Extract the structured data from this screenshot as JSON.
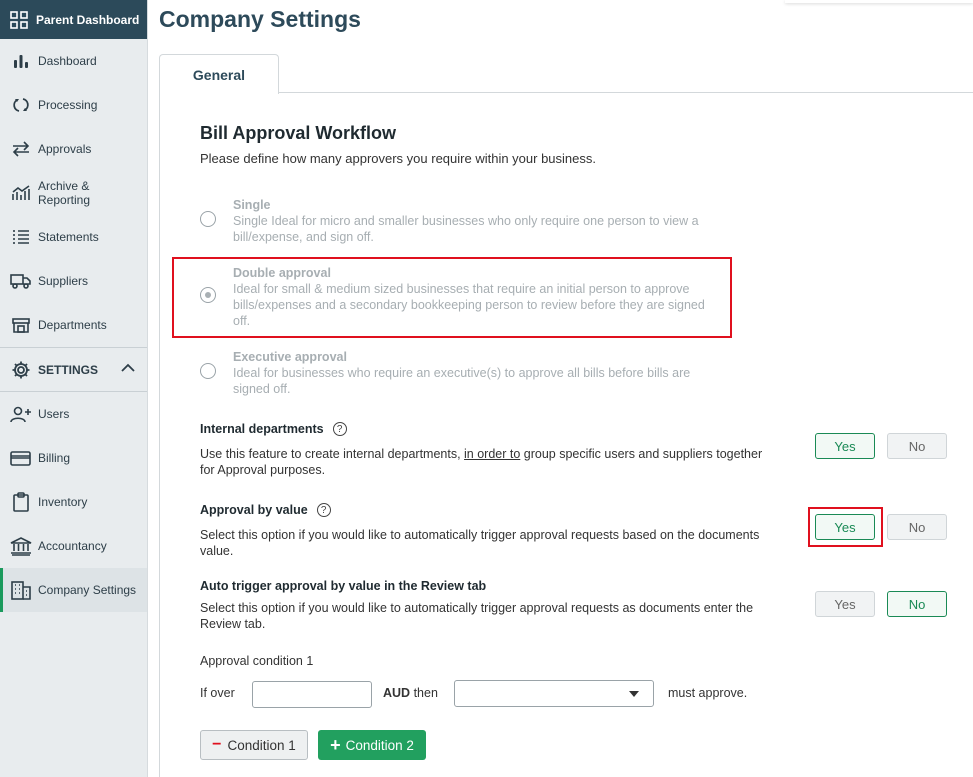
{
  "sidebar": {
    "top_label": "Parent Dashboard",
    "items": [
      {
        "label": "Dashboard",
        "icon": "bar-chart-icon"
      },
      {
        "label": "Processing",
        "icon": "refresh-icon"
      },
      {
        "label": "Approvals",
        "icon": "swap-arrows-icon"
      },
      {
        "label_line1": "Archive &",
        "label_line2": "Reporting",
        "icon": "trend-chart-icon"
      },
      {
        "label": "Statements",
        "icon": "list-icon"
      },
      {
        "label": "Suppliers",
        "icon": "truck-icon"
      },
      {
        "label": "Departments",
        "icon": "department-icon"
      }
    ],
    "settings_label": "SETTINGS",
    "settings_items": [
      {
        "label": "Users",
        "icon": "add-user-icon"
      },
      {
        "label": "Billing",
        "icon": "card-icon"
      },
      {
        "label": "Inventory",
        "icon": "clipboard-icon"
      },
      {
        "label": "Accountancy",
        "icon": "bank-icon"
      },
      {
        "label": "Company Settings",
        "icon": "building-icon"
      }
    ],
    "active_item": "Company Settings"
  },
  "page": {
    "title": "Company Settings",
    "tab": "General"
  },
  "workflow": {
    "heading": "Bill Approval Workflow",
    "subheading": "Please define how many approvers you require within your business.",
    "options": [
      {
        "title": "Single",
        "desc": "Single Ideal for micro and smaller businesses who only require one person to view a bill/expense, and sign off.",
        "checked": false
      },
      {
        "title": "Double approval",
        "desc": "Ideal for small & medium sized businesses that require an initial person to approve bills/expenses and a secondary bookkeeping person to review before they are signed off.",
        "checked": true
      },
      {
        "title": "Executive approval",
        "desc": "Ideal for businesses who require an executive(s) to approve all bills before bills are signed off.",
        "checked": false
      }
    ]
  },
  "internal_departments": {
    "title": "Internal departments",
    "desc_before": "Use this feature to create internal departments, ",
    "desc_link": "in order to",
    "desc_after": " group specific users and suppliers together for Approval purposes.",
    "yes": "Yes",
    "no": "No",
    "value": "Yes"
  },
  "approval_by_value": {
    "title": "Approval by value",
    "desc": "Select this option if you would like to automatically trigger approval requests based on the documents value.",
    "yes": "Yes",
    "no": "No",
    "value": "Yes"
  },
  "auto_trigger": {
    "title": "Auto trigger approval by value in the Review tab",
    "desc": "Select this option if you would like to automatically trigger approval requests as documents enter the Review tab.",
    "yes": "Yes",
    "no": "No",
    "value": "No"
  },
  "condition": {
    "label": "Approval condition 1",
    "if_over": "If over",
    "amount_value": "",
    "currency": "AUD",
    "then": "then",
    "approver_value": "",
    "must_approve": "must approve.",
    "remove_button": "Condition 1",
    "add_button": "Condition 2"
  },
  "colors": {
    "sidebar_top": "#2c4a5a",
    "accent_green": "#22a05f",
    "highlight_red": "#e0101e"
  }
}
